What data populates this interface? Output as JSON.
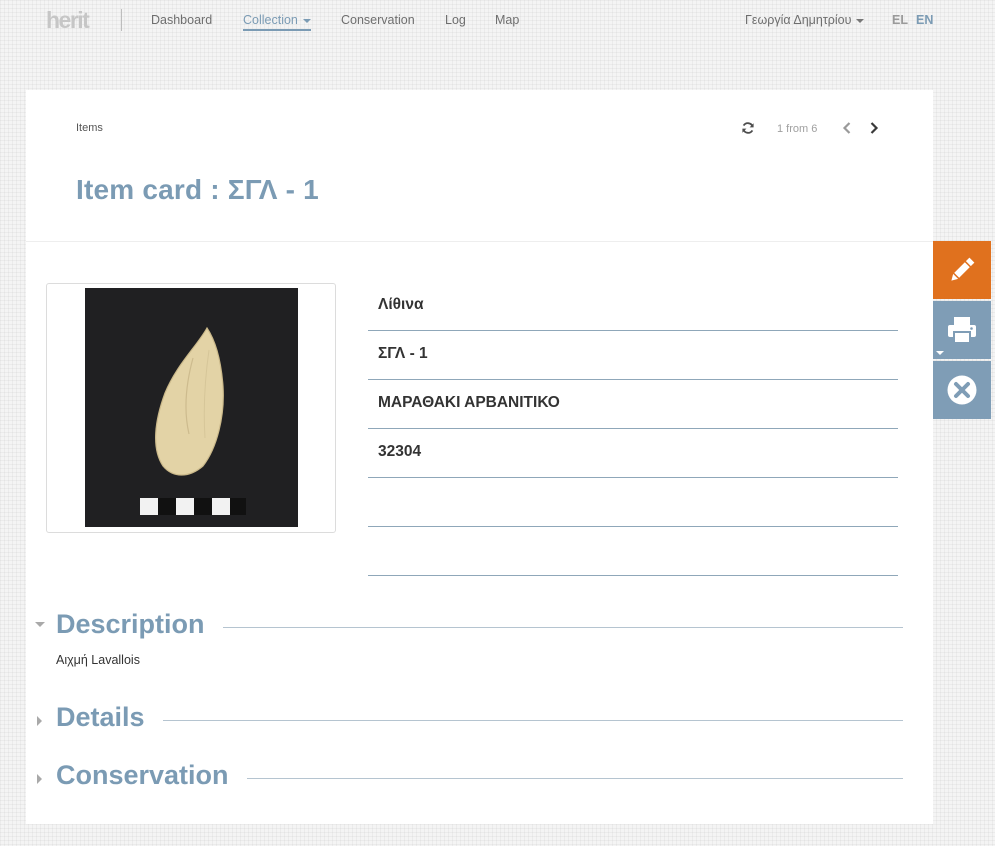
{
  "brand": {
    "logo_text": "herit"
  },
  "nav": {
    "items": [
      {
        "label": "Dashboard",
        "active": false
      },
      {
        "label": "Collection",
        "active": true
      },
      {
        "label": "Conservation",
        "active": false
      },
      {
        "label": "Log",
        "active": false
      },
      {
        "label": "Map",
        "active": false
      }
    ],
    "user_name": "Γεωργία Δημητρίου",
    "lang_el": "EL",
    "lang_en": "EN",
    "active_lang": "EN"
  },
  "header": {
    "breadcrumb": "Items",
    "pager_text": "1 from 6",
    "title": "Item card : ΣΓΛ - 1"
  },
  "fields": [
    "Λίθινα",
    "ΣΓΛ - 1",
    "ΜΑΡΑΘΑΚΙ ΑΡΒΑΝΙΤΙΚΟ",
    "32304",
    "",
    ""
  ],
  "sections": {
    "description": {
      "title": "Description",
      "expanded": true,
      "text": "Αιχμή Lavallois"
    },
    "details": {
      "title": "Details",
      "expanded": false
    },
    "conservation": {
      "title": "Conservation",
      "expanded": false
    }
  },
  "actions": [
    {
      "name": "edit",
      "icon": "pencil-icon",
      "color": "#e0711e"
    },
    {
      "name": "print",
      "icon": "printer-icon",
      "color": "#7f9db6",
      "has_dropdown": true
    },
    {
      "name": "close",
      "icon": "close-circle-icon",
      "color": "#7f9db6"
    }
  ],
  "colors": {
    "accent": "#7b9bb4",
    "edit_orange": "#e0711e",
    "action_blue": "#7f9db6",
    "field_divider": "#8fa7b9"
  }
}
